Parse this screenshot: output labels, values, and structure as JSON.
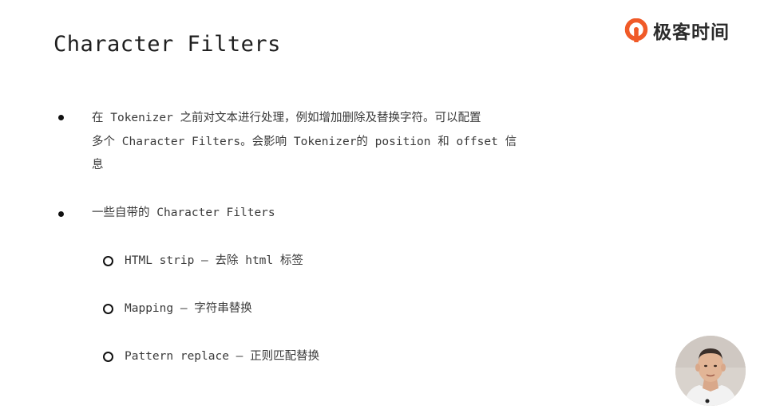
{
  "slide": {
    "title": "Character Filters"
  },
  "logo": {
    "text": "极客时间",
    "brand_color": "#F05A28",
    "icon": "geektime-logo-icon"
  },
  "bullets": [
    {
      "lines": [
        "在 Tokenizer 之前对文本进行处理，例如增加删除及替换字符。可以配置",
        "多个 Character Filters。会影响 Tokenizer的 position 和 offset 信",
        "息"
      ]
    },
    {
      "lines": [
        "一些自带的 Character Filters"
      ]
    }
  ],
  "sub_items": [
    {
      "text": "HTML strip  –  去除 html 标签"
    },
    {
      "text": "Mapping  –  字符串替换"
    },
    {
      "text": "Pattern replace  –  正则匹配替换"
    }
  ],
  "presenter": {
    "icon": "presenter-video-icon"
  }
}
